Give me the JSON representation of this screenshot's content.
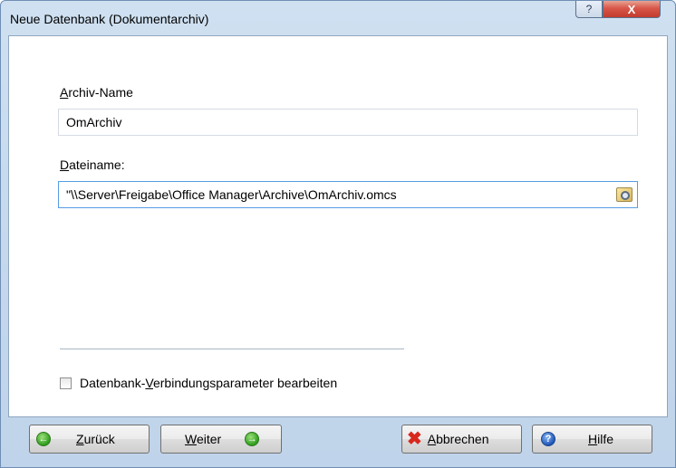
{
  "window": {
    "title": "Neue Datenbank (Dokumentarchiv)",
    "help_glyph": "?",
    "close_glyph": "X"
  },
  "form": {
    "archive_name": {
      "label_first": "A",
      "label_rest": "rchiv-Name",
      "value": "OmArchiv"
    },
    "file_name": {
      "label_first": "D",
      "label_rest": "ateiname:",
      "value": "\"\\\\Server\\Freigabe\\Office Manager\\Archive\\OmArchiv.omcs"
    },
    "connection_params": {
      "label_pre": "Datenbank-",
      "label_mnemonic": "V",
      "label_rest": "erbindungsparameter bearbeiten",
      "checked": false
    }
  },
  "buttons": {
    "back": {
      "mnemonic": "Z",
      "rest": "urück",
      "icon_glyph": "←"
    },
    "next": {
      "mnemonic": "W",
      "rest": "eiter",
      "icon_glyph": "→"
    },
    "cancel": {
      "mnemonic": "A",
      "rest": "bbrechen",
      "icon_glyph": "✖"
    },
    "help": {
      "mnemonic": "H",
      "rest": "ilfe",
      "icon_glyph": "?"
    }
  },
  "colors": {
    "title_bar": "#c4d7ec",
    "close_button": "#c94134",
    "green_icon": "#2f9e1c",
    "blue_icon": "#1f56b8",
    "focus_border": "#569de5"
  }
}
